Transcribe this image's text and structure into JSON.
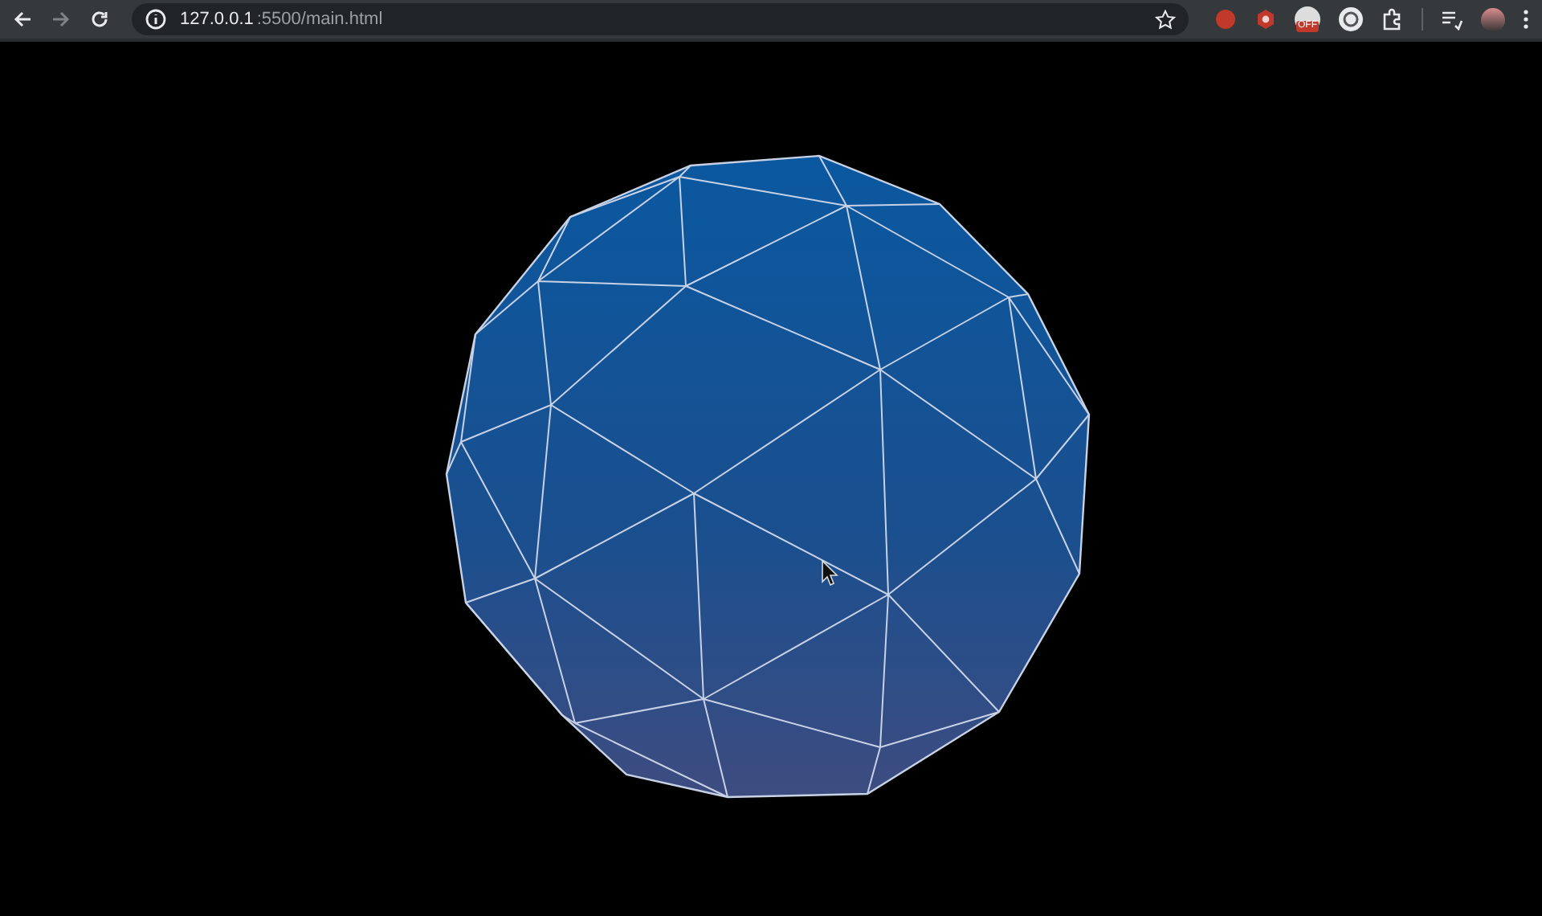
{
  "browser": {
    "forward_disabled": true,
    "url_host": "127.0.0.1",
    "url_path": ":5500/main.html",
    "extension_badge": "OFF"
  }
}
